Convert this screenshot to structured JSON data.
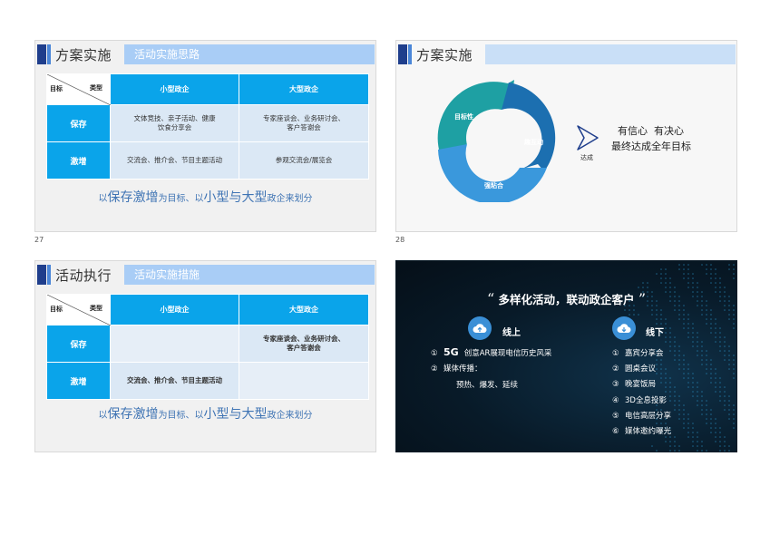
{
  "slide1": {
    "page": "27",
    "title": "方案实施",
    "subtitle": "活动实施思路",
    "corner_left": "目标",
    "corner_right": "类型",
    "col1": "小型政企",
    "col2": "大型政企",
    "row1": "保存",
    "row2": "激增",
    "r1c1": "文体竞技、亲子活动、健康饮食分享会",
    "r1c2": "专家座谈会、业务研讨会、客户答谢会",
    "r2c1": "交流会、推介会、节目主题活动",
    "r2c2": "参观交流会/展览会",
    "caption": {
      "p1": "以",
      "p2": "保存激增",
      "p3": "为目标、以",
      "p4": "小型与大型",
      "p5": "政企来划分"
    }
  },
  "slide2": {
    "page": "28",
    "title": "方案实施",
    "seg1": "目标性",
    "seg2": "趣互动",
    "seg3": "强粘合",
    "arrow_label": "达成",
    "line1": "有信心  有决心",
    "line2": "最终达成全年目标",
    "colors": {
      "teal": "#1ea0a3",
      "blue_dark": "#1c6fb0",
      "blue_light": "#3a98dc"
    }
  },
  "slide3": {
    "title": "活动执行",
    "subtitle": "活动实施措施",
    "corner_left": "目标",
    "corner_right": "类型",
    "col1": "小型政企",
    "col2": "大型政企",
    "row1": "保存",
    "row2": "激增",
    "r1c1": "",
    "r1c2": "专家座谈会、业务研讨会、客户答谢会",
    "r2c1": "交流会、推介会、节目主题活动",
    "r2c2": "",
    "caption": {
      "p1": "以",
      "p2": "保存激增",
      "p3": "为目标、以",
      "p4": "小型与大型",
      "p5": "政企来划分"
    }
  },
  "slide4": {
    "title": "多样化活动，联动政企客户",
    "quote_open": "“",
    "quote_close": "”",
    "online_label": "线上",
    "offline_label": "线下",
    "online_items": [
      {
        "num": "①",
        "strong": "5G",
        "text": "创意AR展现电信历史风采"
      },
      {
        "num": "②",
        "strong": "",
        "text": "媒体传播："
      },
      {
        "num": "",
        "strong": "",
        "text": "预热、爆发、延续"
      }
    ],
    "offline_items": [
      {
        "num": "①",
        "text": "嘉宾分享会"
      },
      {
        "num": "②",
        "text": "圆桌会议"
      },
      {
        "num": "③",
        "text": "晚宴饭局"
      },
      {
        "num": "④",
        "text": "3D全息投影"
      },
      {
        "num": "⑤",
        "text": "电信高层分享"
      },
      {
        "num": "⑥",
        "text": "媒体邀约曝光"
      }
    ]
  }
}
